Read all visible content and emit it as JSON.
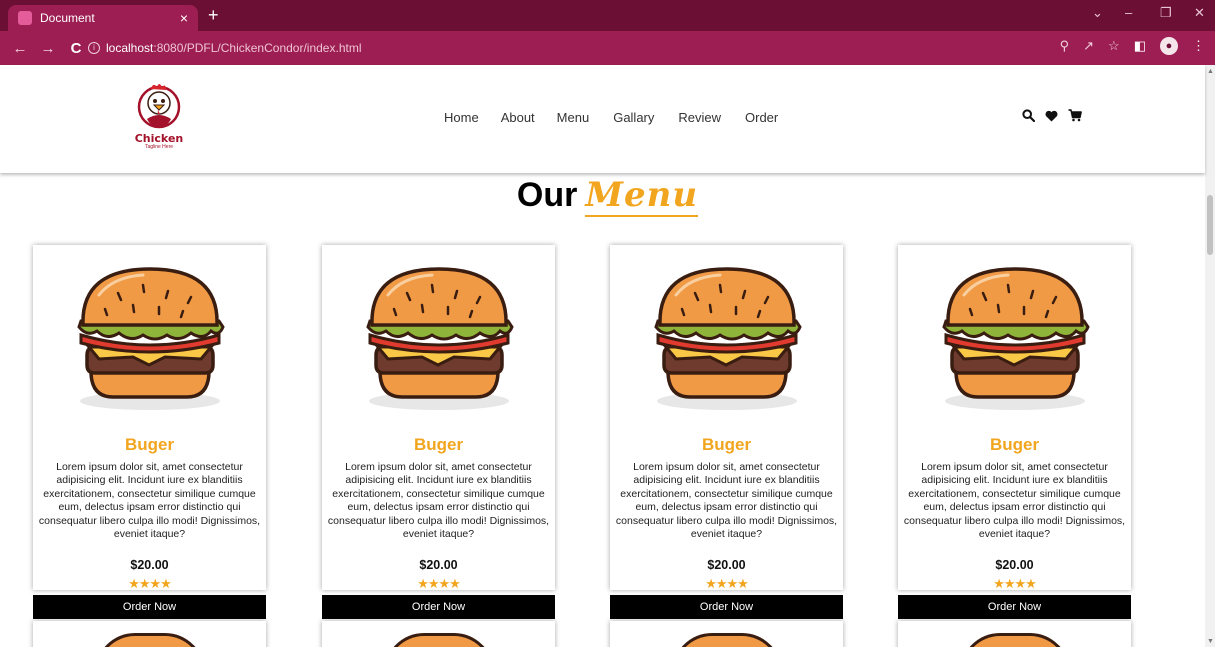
{
  "browser": {
    "tab_title": "Document",
    "tab_close": "×",
    "new_tab": "+",
    "url_host": "localhost",
    "url_path": ":8080/PDFL/ChickenCondor/index.html"
  },
  "logo": {
    "name": "Chicken",
    "tagline": "Tagline Here"
  },
  "nav": [
    "Home",
    "About",
    "Menu",
    "Gallary",
    "Review",
    "Order"
  ],
  "section": {
    "title": "Our",
    "accent": "Menu"
  },
  "menu_items": [
    {
      "title": "Buger",
      "description": "Lorem ipsum dolor sit, amet consectetur adipisicing elit. Incidunt iure ex blanditiis exercitationem, consectetur similique cumque eum, delectus ipsam error distinctio qui consequatur libero culpa illo modi! Dignissimos, eveniet itaque?",
      "price": "$20.00",
      "rating": 4,
      "button": "Order Now"
    },
    {
      "title": "Buger",
      "description": "Lorem ipsum dolor sit, amet consectetur adipisicing elit. Incidunt iure ex blanditiis exercitationem, consectetur similique cumque eum, delectus ipsam error distinctio qui consequatur libero culpa illo modi! Dignissimos, eveniet itaque?",
      "price": "$20.00",
      "rating": 4,
      "button": "Order Now"
    },
    {
      "title": "Buger",
      "description": "Lorem ipsum dolor sit, amet consectetur adipisicing elit. Incidunt iure ex blanditiis exercitationem, consectetur similique cumque eum, delectus ipsam error distinctio qui consequatur libero culpa illo modi! Dignissimos, eveniet itaque?",
      "price": "$20.00",
      "rating": 4,
      "button": "Order Now"
    },
    {
      "title": "Buger",
      "description": "Lorem ipsum dolor sit, amet consectetur adipisicing elit. Incidunt iure ex blanditiis exercitationem, consectetur similique cumque eum, delectus ipsam error distinctio qui consequatur libero culpa illo modi! Dignissimos, eveniet itaque?",
      "price": "$20.00",
      "rating": 4,
      "button": "Order Now"
    }
  ],
  "colors": {
    "accent": "#f2a51e",
    "chrome_dark": "#6b0f35",
    "chrome": "#9c1e52",
    "logo_red": "#a3122a"
  },
  "icons": {
    "search": "search-icon",
    "wishlist": "heart-icon",
    "cart": "cart-icon"
  }
}
